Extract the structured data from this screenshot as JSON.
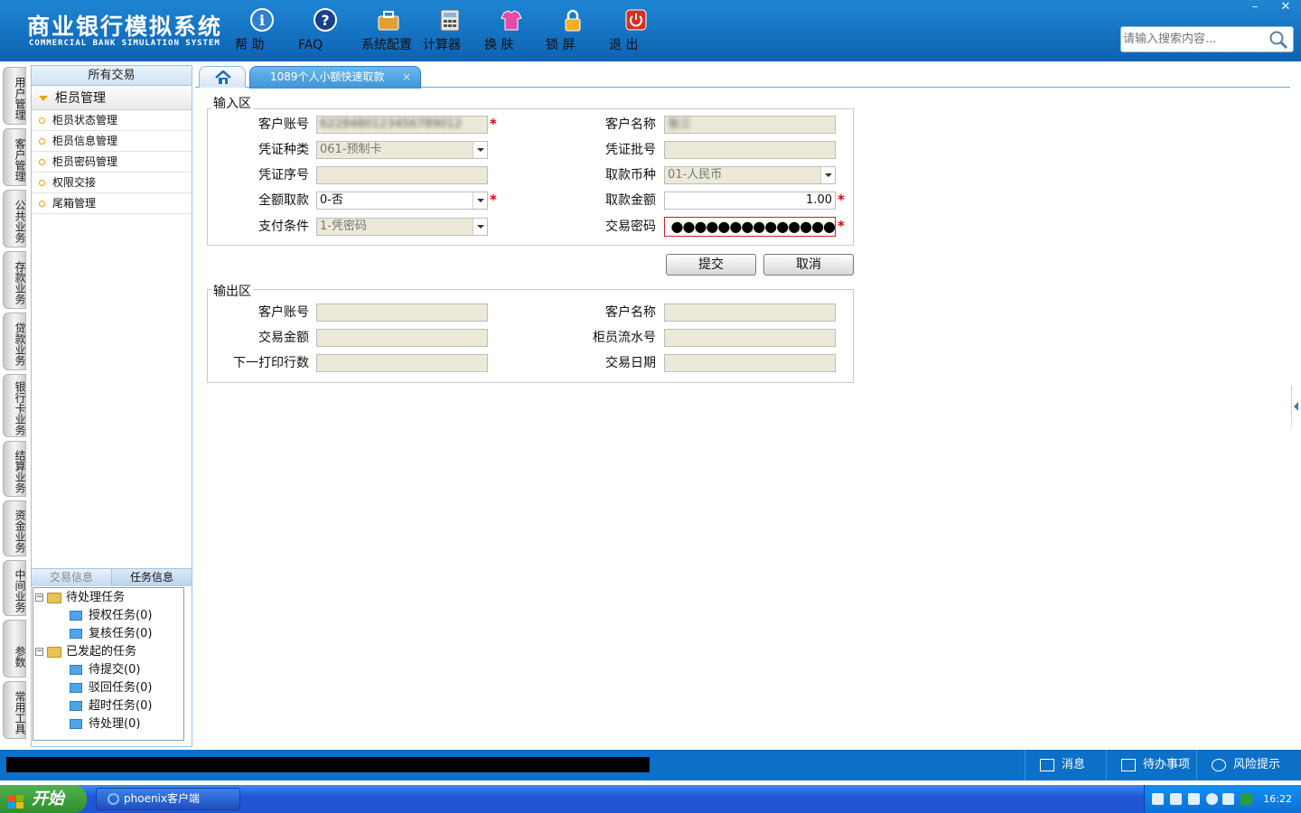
{
  "header": {
    "title_cn": "商业银行模拟系统",
    "title_en": "COMMERCIAL BANK SIMULATION SYSTEM",
    "tools": [
      {
        "label": "帮 助",
        "icon": "info-icon"
      },
      {
        "label": "FAQ",
        "icon": "question-icon"
      },
      {
        "label": "系统配置",
        "icon": "toolbox-icon"
      },
      {
        "label": "计算器",
        "icon": "calculator-icon"
      },
      {
        "label": "换 肤",
        "icon": "shirt-icon"
      },
      {
        "label": "锁 屏",
        "icon": "lock-icon"
      },
      {
        "label": "退 出",
        "icon": "power-icon"
      }
    ],
    "search_placeholder": "请输入搜索内容...",
    "min_glyph": "–",
    "close_glyph": "✕"
  },
  "vtabs": [
    "用户管理",
    "客户管理",
    "公共业务",
    "存款业务",
    "贷款业务",
    "银行卡业务",
    "结算业务",
    "资金业务",
    "中间业务",
    "参数",
    "常用工具"
  ],
  "leftpanel": {
    "header": "所有交易",
    "group": "柜员管理",
    "items": [
      "柜员状态管理",
      "柜员信息管理",
      "柜员密码管理",
      "权限交接",
      "尾箱管理"
    ],
    "tab_trade": "交易信息",
    "tab_task": "任务信息",
    "tree": {
      "pending": "待处理任务",
      "auth": "授权任务(0)",
      "review": "复核任务(0)",
      "initiated": "已发起的任务",
      "to_submit": "待提交(0)",
      "rejected": "驳回任务(0)",
      "timeout": "超时任务(0)",
      "to_process": "待处理(0)"
    }
  },
  "tabs": {
    "active": "1089个人小额快速取款",
    "close": "×"
  },
  "input": {
    "title": "输入区",
    "account_label": "客户账号",
    "account_value": "6228480123456789012",
    "name_label": "客户名称",
    "name_value": "张三",
    "voucher_type_label": "凭证种类",
    "voucher_type_value": "061-预制卡",
    "voucher_batch_label": "凭证批号",
    "voucher_batch_value": "",
    "voucher_seq_label": "凭证序号",
    "voucher_seq_value": "",
    "currency_label": "取款币种",
    "currency_value": "01-人民币",
    "full_label": "全额取款",
    "full_value": "0-否",
    "amount_label": "取款金额",
    "amount_value": "1.00",
    "pay_label": "支付条件",
    "pay_value": "1-凭密码",
    "pwd_label": "交易密码",
    "pwd_value": "●●●●●●●●●●●●●●",
    "req": "*"
  },
  "buttons": {
    "submit": "提交",
    "cancel": "取消"
  },
  "output": {
    "title": "输出区",
    "account_label": "客户账号",
    "name_label": "客户名称",
    "amount_label": "交易金额",
    "serial_label": "柜员流水号",
    "lines_label": "下一打印行数",
    "date_label": "交易日期"
  },
  "status": {
    "msg": "消息",
    "todo": "待办事项",
    "risk": "风险提示"
  },
  "taskbar": {
    "start": "开始",
    "app": "phoenix客户端",
    "time": "16:22"
  }
}
